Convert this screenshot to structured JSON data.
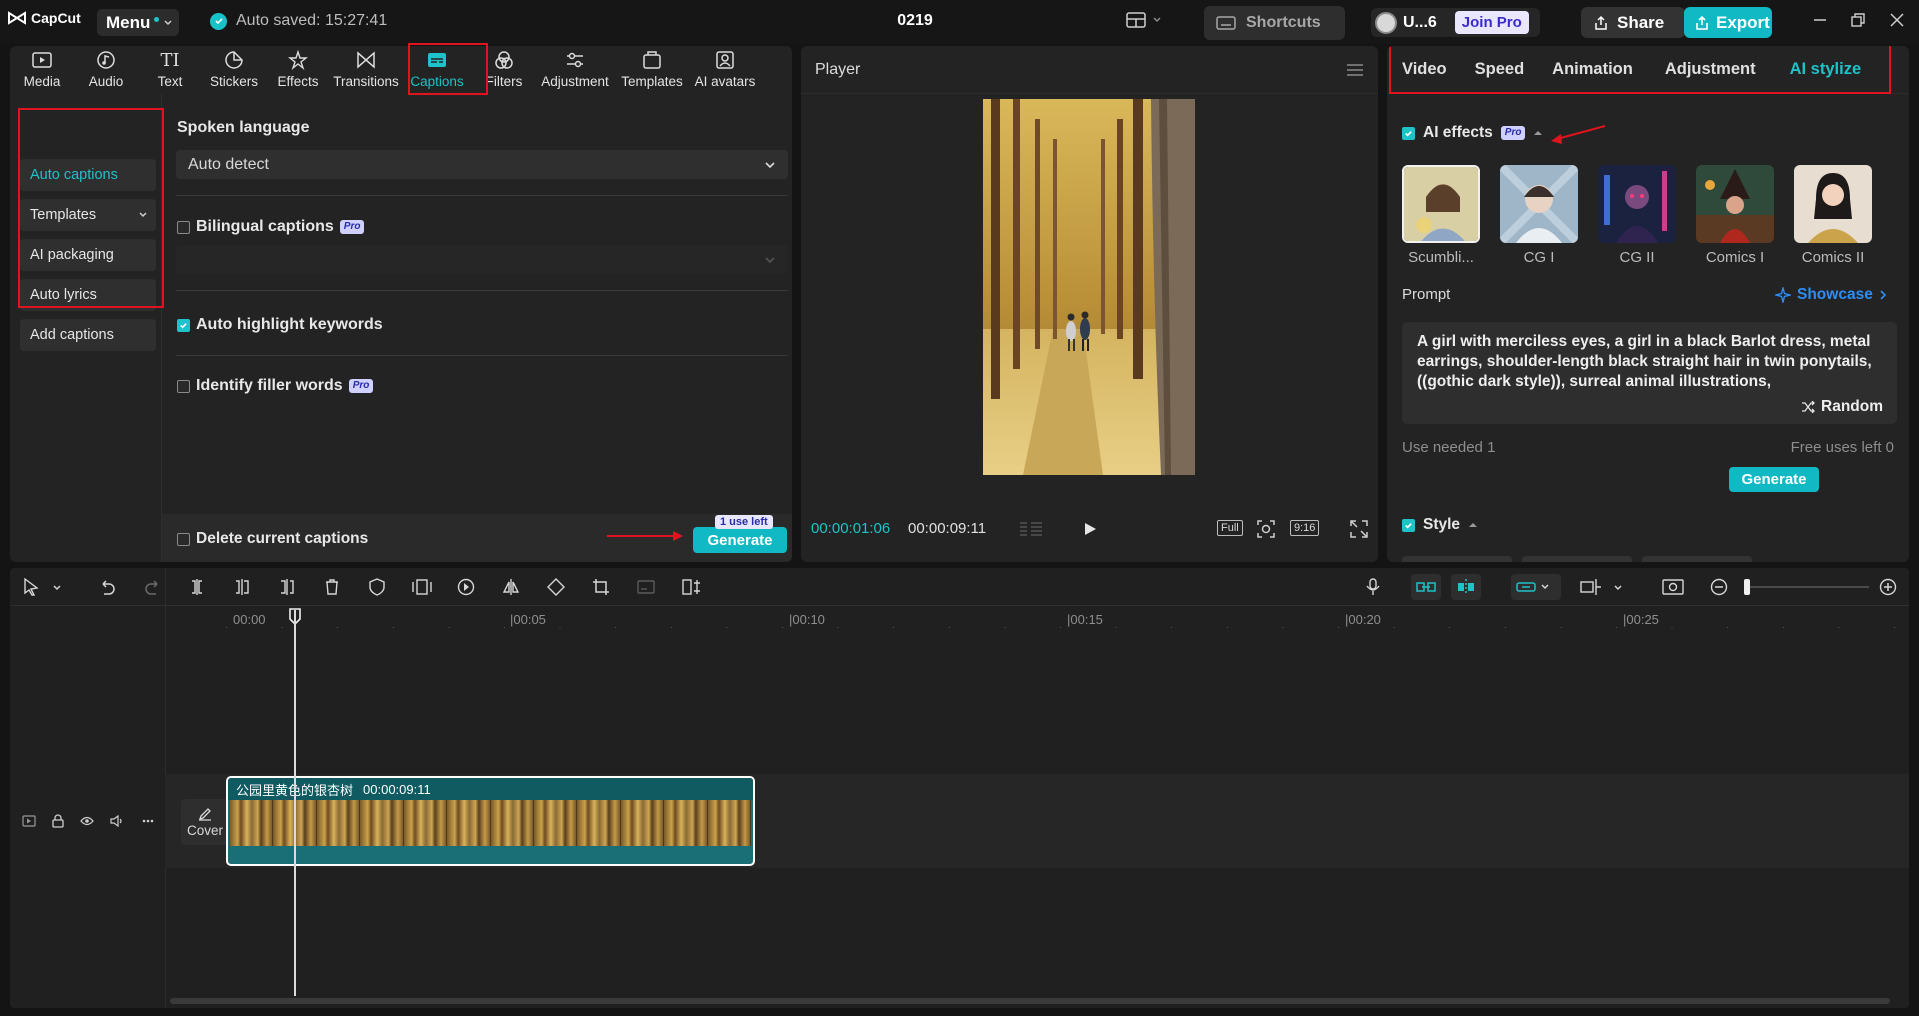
{
  "app": {
    "logo_text": "CapCut",
    "menu_label": "Menu",
    "autosave_text": "Auto saved: 15:27:41",
    "project_title": "0219",
    "shortcuts_label": "Shortcuts",
    "user_label": "U...6",
    "join_pro_label": "Join Pro",
    "share_label": "Share",
    "export_label": "Export"
  },
  "tools": {
    "tabs": [
      {
        "label": "Media",
        "icon": "media-icon"
      },
      {
        "label": "Audio",
        "icon": "audio-icon"
      },
      {
        "label": "Text",
        "icon": "text-icon"
      },
      {
        "label": "Stickers",
        "icon": "stickers-icon"
      },
      {
        "label": "Effects",
        "icon": "effects-icon"
      },
      {
        "label": "Transitions",
        "icon": "transitions-icon"
      },
      {
        "label": "Captions",
        "icon": "captions-icon",
        "active": true
      },
      {
        "label": "Filters",
        "icon": "filters-icon"
      },
      {
        "label": "Adjustment",
        "icon": "adjustment-icon"
      },
      {
        "label": "Templates",
        "icon": "templates-icon"
      },
      {
        "label": "AI avatars",
        "icon": "ai-avatars-icon"
      }
    ]
  },
  "captions": {
    "nav": [
      {
        "label": "Auto captions",
        "active": true
      },
      {
        "label": "Templates"
      },
      {
        "label": "AI packaging"
      },
      {
        "label": "Auto lyrics"
      },
      {
        "label": "Add captions"
      }
    ],
    "spoken_language_label": "Spoken language",
    "spoken_language_value": "Auto detect",
    "bilingual_label": "Bilingual captions",
    "pro_badge": "Pro",
    "highlight_label": "Auto highlight keywords",
    "filler_label": "Identify filler words",
    "delete_label": "Delete current captions",
    "use_left_badge": "1 use left",
    "generate_label": "Generate"
  },
  "player": {
    "title": "Player",
    "current_time": "00:00:01:06",
    "total_time": "00:00:09:11",
    "full_label": "Full",
    "ratio_label": "9:16"
  },
  "inspector": {
    "tabs": [
      {
        "label": "Video"
      },
      {
        "label": "Speed"
      },
      {
        "label": "Animation"
      },
      {
        "label": "Adjustment"
      },
      {
        "label": "AI stylize",
        "active": true
      }
    ],
    "ai_effects_label": "AI effects",
    "pro_badge": "Pro",
    "styles": [
      {
        "label": "Scumbli...",
        "selected": true
      },
      {
        "label": "CG I"
      },
      {
        "label": "CG II"
      },
      {
        "label": "Comics I"
      },
      {
        "label": "Comics II"
      }
    ],
    "prompt_label": "Prompt",
    "showcase_label": "Showcase",
    "prompt_text": "A girl with merciless eyes, a girl in a black Barlot dress, metal earrings, shoulder-length black straight hair in twin ponytails, ((gothic dark style)), surreal animal illustrations,",
    "random_label": "Random",
    "use_needed": "Use needed 1",
    "free_uses": "Free uses left 0",
    "generate_label": "Generate",
    "style_label": "Style"
  },
  "timeline": {
    "ruler": [
      "00:00",
      "|00:05",
      "|00:10",
      "|00:15",
      "|00:20",
      "|00:25"
    ],
    "clip_name": "公园里黄色的银杏树",
    "clip_duration": "00:00:09:11",
    "cover_label": "Cover"
  },
  "colors": {
    "accent": "#1ec2c9",
    "highlight_box": "#e0141e",
    "background": "#141414",
    "panel": "#232323"
  }
}
